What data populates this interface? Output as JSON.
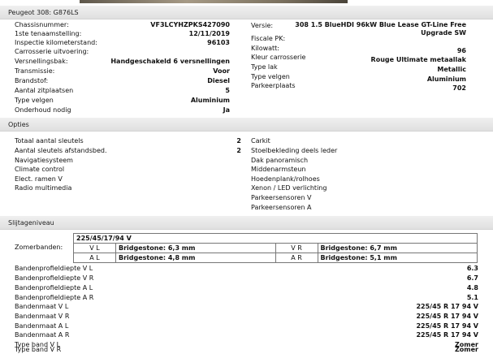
{
  "vehicle_title": "Peugeot 308: G876LS",
  "details_left": [
    {
      "label": "Chassisnummer:",
      "value": "VF3LCYHZPKS427090"
    },
    {
      "label": "1ste tenaamstelling:",
      "value": "12/11/2019"
    },
    {
      "label": "Inspectie kilometerstand:",
      "value": "96103"
    },
    {
      "label": "Carrosserie uitvoering:",
      "value": ""
    },
    {
      "label": "Versnellingsbak:",
      "value": "Handgeschakeld 6 versnellingen"
    },
    {
      "label": "Transmissie:",
      "value": "Voor"
    },
    {
      "label": "Brandstof:",
      "value": "Diesel"
    },
    {
      "label": "Aantal zitplaatsen",
      "value": "5"
    },
    {
      "label": "Type velgen",
      "value": "Aluminium"
    },
    {
      "label": "Onderhoud nodig",
      "value": "Ja"
    }
  ],
  "details_right": {
    "versie": {
      "label": "Versie:",
      "value": "308 1.5 BlueHDI 96kW Blue Lease GT-Line Free Upgrade SW"
    },
    "rows": [
      {
        "label": "Fiscale PK:",
        "value": ""
      },
      {
        "label": "Kilowatt:",
        "value": "96"
      },
      {
        "label": "Kleur carrosserie",
        "value": "Rouge Ultimate metaallak"
      },
      {
        "label": "Type lak",
        "value": "Metallic"
      },
      {
        "label": "Type velgen",
        "value": "Aluminium"
      },
      {
        "label": "Parkeerplaats",
        "value": "702"
      }
    ]
  },
  "opties": {
    "title": "Opties",
    "left": [
      {
        "label": "Totaal aantal sleutels",
        "value": "2"
      },
      {
        "label": "Aantal sleutels afstandsbed.",
        "value": "2"
      },
      {
        "label": "Navigatiesysteem",
        "value": ""
      },
      {
        "label": "Climate control",
        "value": ""
      },
      {
        "label": "Elect. ramen V",
        "value": ""
      },
      {
        "label": "Radio multimedia",
        "value": ""
      }
    ],
    "right": [
      "Carkit",
      "Stoelbekleding deels leder",
      "Dak panoramisch",
      "Middenarmsteun",
      "Hoedenplank/rolhoes",
      "Xenon / LED verlichting",
      "Parkeersensoren V",
      "Parkeersensoren A"
    ]
  },
  "slijtage": {
    "title": "Slijtageniveau",
    "size": "225/45/17/94 V",
    "zomer_label": "Zomerbanden:",
    "tires": [
      {
        "pos_l": "V L",
        "val_l": "Bridgestone: 6,3 mm",
        "pos_r": "V R",
        "val_r": "Bridgestone: 6,7 mm"
      },
      {
        "pos_l": "A L",
        "val_l": "Bridgestone: 4,8 mm",
        "pos_r": "A R",
        "val_r": "Bridgestone: 5,1 mm"
      }
    ],
    "rows": [
      {
        "label": "Bandenprofieldiepte V L",
        "value": "6.3"
      },
      {
        "label": "Bandenprofieldiepte V R",
        "value": "6.7"
      },
      {
        "label": "Bandenprofieldiepte A L",
        "value": "4.8"
      },
      {
        "label": "Bandenprofieldiepte A R",
        "value": "5.1"
      },
      {
        "label": "Bandenmaat V L",
        "value": "225/45 R 17 94 V"
      },
      {
        "label": "Bandenmaat V R",
        "value": "225/45 R 17 94 V"
      },
      {
        "label": "Bandenmaat A L",
        "value": "225/45 R 17 94 V"
      },
      {
        "label": "Bandenmaat A R",
        "value": "225/45 R 17 94 V"
      },
      {
        "label": "Type band V L",
        "value": "Zomer"
      },
      {
        "label": "Type band V R",
        "value": "Zomer"
      }
    ]
  }
}
